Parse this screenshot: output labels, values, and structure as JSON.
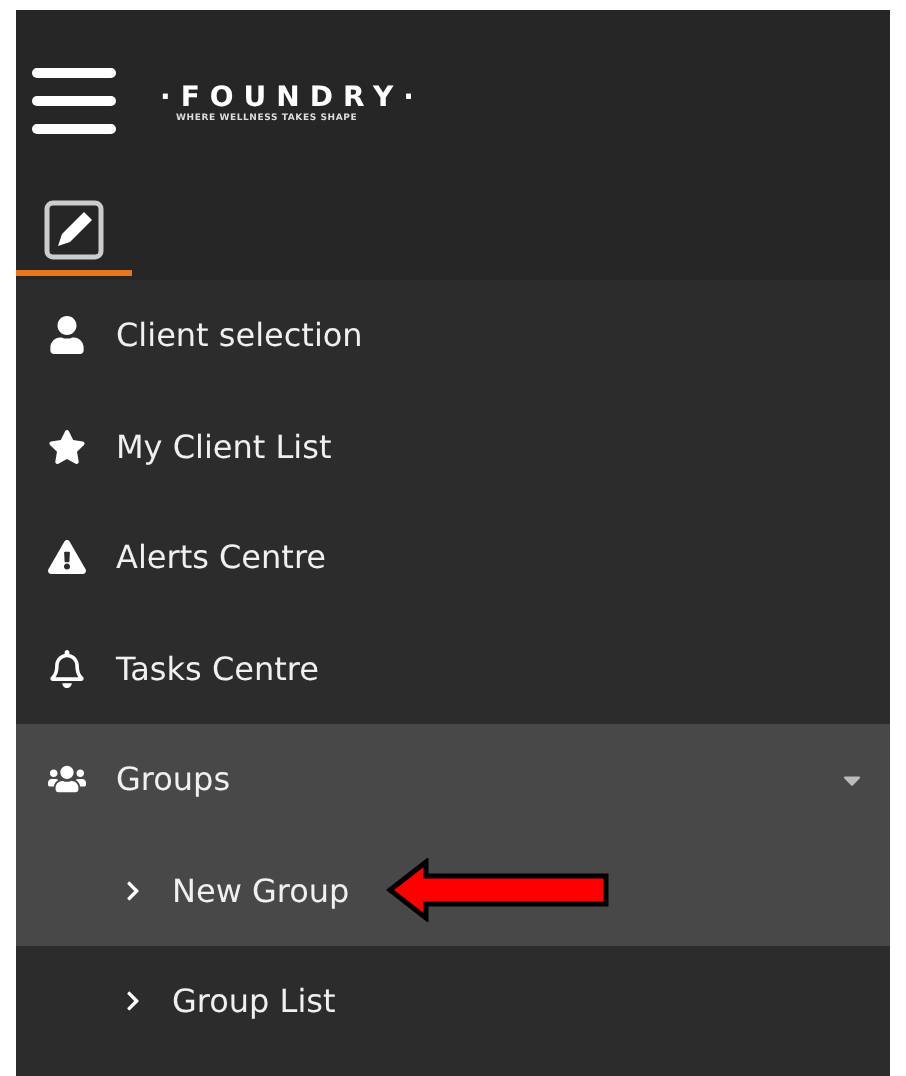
{
  "header": {
    "logo": "·FOUNDRY·",
    "tagline": "WHERE WELLNESS TAKES SHAPE"
  },
  "tabs": [
    {
      "kind": "edit",
      "selected": true
    }
  ],
  "menu": [
    {
      "kind": "person",
      "label": "Client selection"
    },
    {
      "kind": "star",
      "label": "My Client List"
    },
    {
      "kind": "alert",
      "label": "Alerts Centre"
    },
    {
      "kind": "bell",
      "label": "Tasks Centre"
    },
    {
      "kind": "users",
      "label": "Groups",
      "expanded": true,
      "children": [
        {
          "label": "New Group",
          "selected": true,
          "annotated": true
        },
        {
          "label": "Group List",
          "selected": false,
          "annotated": false
        }
      ]
    }
  ]
}
